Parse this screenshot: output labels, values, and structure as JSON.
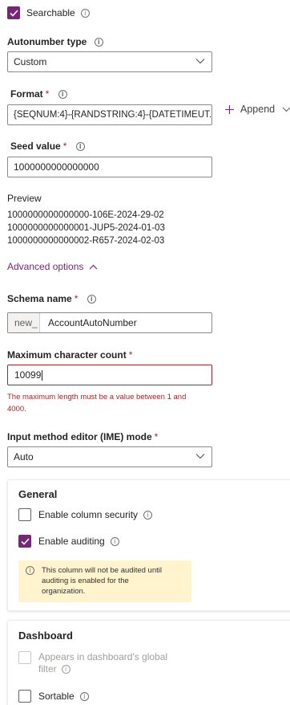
{
  "searchable": {
    "label": "Searchable",
    "checked": true
  },
  "autonumber_type": {
    "label": "Autonumber type",
    "value": "Custom"
  },
  "format": {
    "label": "Format",
    "required_mark": "*",
    "value": "{SEQNUM:4}-{RANDSTRING:4}-{DATETIMEUT...",
    "append_label": "Append"
  },
  "seed": {
    "label": "Seed value",
    "required_mark": "*",
    "value": "1000000000000000"
  },
  "preview": {
    "label": "Preview",
    "lines": [
      "1000000000000000-106E-2024-29-02",
      "1000000000000001-JUP5-2024-01-03",
      "1000000000000002-R657-2024-02-03"
    ]
  },
  "advanced_options": {
    "label": "Advanced options"
  },
  "schema_name": {
    "label": "Schema name",
    "required_mark": "*",
    "prefix": "new_",
    "value": "AccountAutoNumber"
  },
  "max_char_count": {
    "label": "Maximum character count",
    "required_mark": "*",
    "value": "10099",
    "error_line1": "The maximum length must be a value between 1 and",
    "error_line2": "4000."
  },
  "ime_mode": {
    "label": "Input method editor (IME) mode",
    "required_mark": "*",
    "value": "Auto"
  },
  "general": {
    "title": "General",
    "column_security": {
      "label": "Enable column security",
      "checked": false
    },
    "auditing": {
      "label": "Enable auditing",
      "checked": true
    },
    "notice_line1": "This column will not be audited until",
    "notice_line2": "auditing is enabled for the",
    "notice_line3": "organization."
  },
  "dashboard": {
    "title": "Dashboard",
    "global_filter_line1": "Appears in dashboard's global",
    "global_filter_line2": "filter",
    "sortable": "Sortable"
  },
  "colors": {
    "accent": "#742774",
    "error": "#a4262c",
    "notice_bg": "#fff4ce"
  }
}
